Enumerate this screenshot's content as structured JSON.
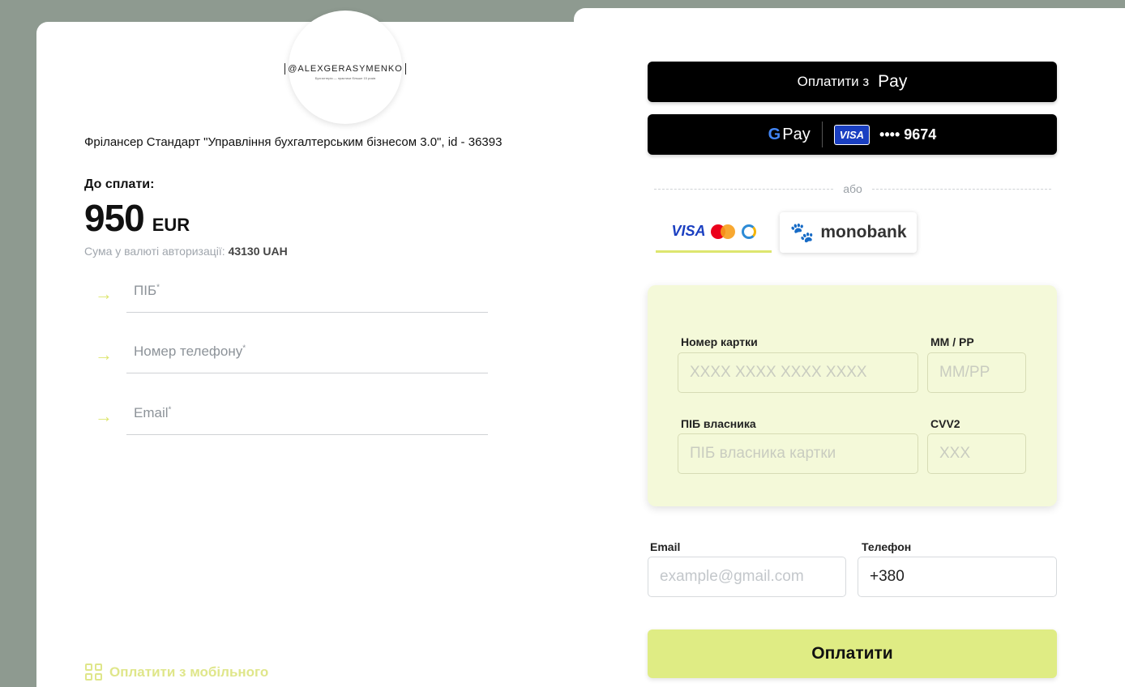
{
  "merchant": {
    "brand": "@ALEXGERASYMENKO",
    "tagline": "Бухгалтерія — практики більше 15 років"
  },
  "order": {
    "title": "Фрілансер Стандарт \"Управління бухгалтерським бізнесом 3.0\", id - 36393",
    "due_label": "До сплати:",
    "amount": "950",
    "currency": "EUR",
    "auth_sum_label": "Сума у валюті авторизації:",
    "auth_sum_value": "43130 UAH"
  },
  "buyer_fields": [
    {
      "label": "ПІБ",
      "required": "*"
    },
    {
      "label": "Номер телефону",
      "required": "*"
    },
    {
      "label": "Email",
      "required": "*"
    }
  ],
  "mobile_pay_label": "Оплатити з мобільного",
  "wallets": {
    "apple_pay_prefix": "Оплатити з",
    "apple_logo": "",
    "apple_pay_word": "Pay",
    "google_g": "G",
    "google_pay_word": "Pay",
    "card_brand": "VISA",
    "card_masked": "•••• 9674"
  },
  "or_label": "або",
  "method_tabs": {
    "cards_visa": "VISA",
    "mono_label": "monobank",
    "mono_icon": "paw-icon"
  },
  "card_form": {
    "card_number_label": "Номер картки",
    "card_number_placeholder": "XXXX XXXX XXXX XXXX",
    "expiry_label": "ММ / РР",
    "expiry_placeholder": "ММ/РР",
    "holder_label": "ПІБ власника",
    "holder_placeholder": "ПІБ власника картки",
    "cvv_label": "CVV2",
    "cvv_placeholder": "XXX"
  },
  "contact": {
    "email_label": "Email",
    "email_placeholder": "example@gmail.com",
    "phone_label": "Телефон",
    "phone_value": "+380"
  },
  "submit_label": "Оплатити",
  "colors": {
    "accent": "#dfec84",
    "card_form_bg": "#f4f9d9",
    "page_bg": "#8e9a90",
    "visa_blue": "#1a3fc1"
  }
}
